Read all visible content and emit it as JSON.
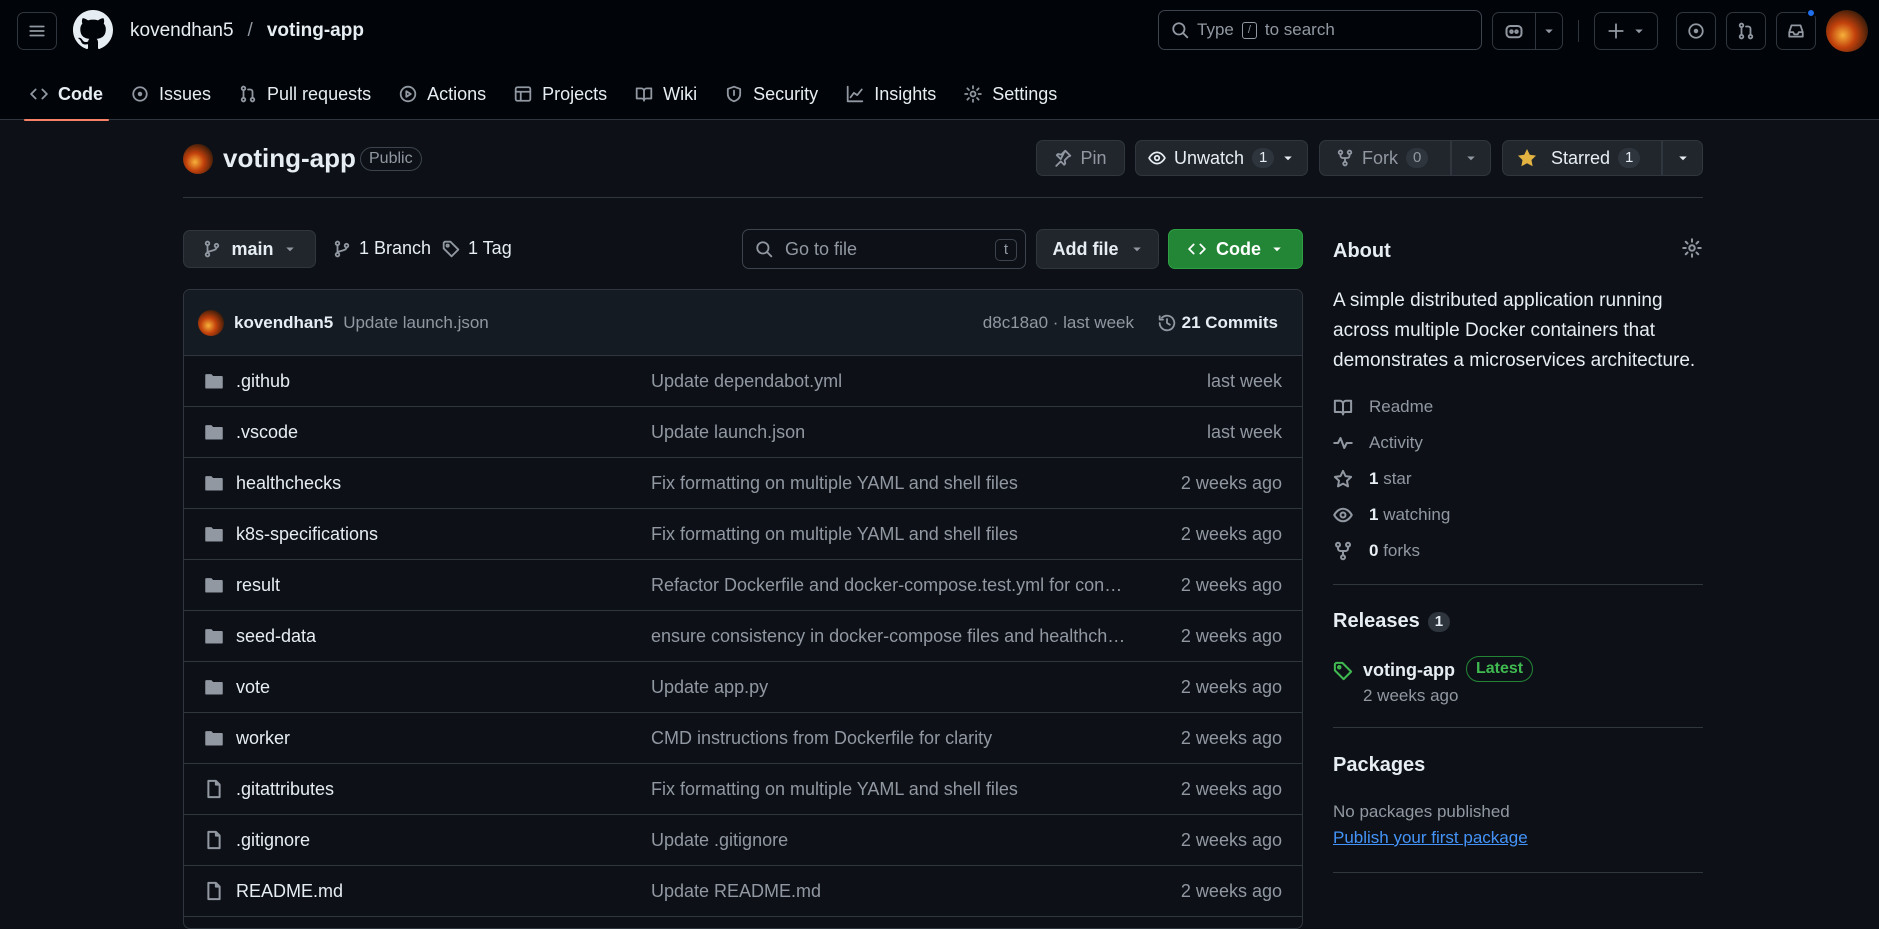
{
  "header": {
    "owner": "kovendhan5",
    "separator": "/",
    "repo": "voting-app",
    "search_prefix": "Type",
    "search_key": "/",
    "search_suffix": "to search"
  },
  "nav": {
    "tabs": [
      {
        "label": "Code",
        "icon": "code-icon"
      },
      {
        "label": "Issues",
        "icon": "issue-icon"
      },
      {
        "label": "Pull requests",
        "icon": "pull-request-icon"
      },
      {
        "label": "Actions",
        "icon": "play-icon"
      },
      {
        "label": "Projects",
        "icon": "table-icon"
      },
      {
        "label": "Wiki",
        "icon": "book-icon"
      },
      {
        "label": "Security",
        "icon": "shield-icon"
      },
      {
        "label": "Insights",
        "icon": "graph-icon"
      },
      {
        "label": "Settings",
        "icon": "gear-icon"
      }
    ]
  },
  "repo": {
    "name": "voting-app",
    "visibility": "Public",
    "pin": "Pin",
    "unwatch": "Unwatch",
    "watch_count": "1",
    "fork": "Fork",
    "fork_count": "0",
    "starred": "Starred",
    "star_count": "1"
  },
  "toolbar": {
    "branch": "main",
    "branches": "1 Branch",
    "tags": "1 Tag",
    "goto_placeholder": "Go to file",
    "goto_key": "t",
    "add_file": "Add file",
    "code": "Code"
  },
  "commit": {
    "author": "kovendhan5",
    "message": "Update launch.json",
    "hash": "d8c18a0 · last week",
    "commits": "21 Commits"
  },
  "files": [
    {
      "type": "dir",
      "name": ".github",
      "message": "Update dependabot.yml",
      "date": "last week"
    },
    {
      "type": "dir",
      "name": ".vscode",
      "message": "Update launch.json",
      "date": "last week"
    },
    {
      "type": "dir",
      "name": "healthchecks",
      "message": "Fix formatting on multiple YAML and shell files",
      "date": "2 weeks ago"
    },
    {
      "type": "dir",
      "name": "k8s-specifications",
      "message": "Fix formatting on multiple YAML and shell files",
      "date": "2 weeks ago"
    },
    {
      "type": "dir",
      "name": "result",
      "message": "Refactor Dockerfile and docker-compose.test.yml for consi...",
      "date": "2 weeks ago"
    },
    {
      "type": "dir",
      "name": "seed-data",
      "message": "ensure consistency in docker-compose files and healthchec...",
      "date": "2 weeks ago"
    },
    {
      "type": "dir",
      "name": "vote",
      "message": "Update app.py",
      "date": "2 weeks ago"
    },
    {
      "type": "dir",
      "name": "worker",
      "message": "CMD instructions from Dockerfile for clarity",
      "date": "2 weeks ago"
    },
    {
      "type": "file",
      "name": ".gitattributes",
      "message": "Fix formatting on multiple YAML and shell files",
      "date": "2 weeks ago"
    },
    {
      "type": "file",
      "name": ".gitignore",
      "message": "Update .gitignore",
      "date": "2 weeks ago"
    },
    {
      "type": "file",
      "name": "README.md",
      "message": "Update README.md",
      "date": "2 weeks ago"
    }
  ],
  "about": {
    "heading": "About",
    "description": "A simple distributed application running across multiple Docker containers that demonstrates a microservices architecture.",
    "readme": "Readme",
    "activity": "Activity",
    "stars_count": "1",
    "stars_label": "star",
    "watching_count": "1",
    "watching_label": "watching",
    "forks_count": "0",
    "forks_label": "forks"
  },
  "releases": {
    "heading": "Releases",
    "count": "1",
    "name": "voting-app",
    "badge": "Latest",
    "date": "2 weeks ago"
  },
  "packages": {
    "heading": "Packages",
    "none": "No packages published",
    "link": "Publish your first package"
  },
  "colors": {
    "bg": "#0d1117",
    "header_bg": "#010409",
    "accent_tab": "#f78166",
    "green": "#238636",
    "link": "#4493f8"
  }
}
